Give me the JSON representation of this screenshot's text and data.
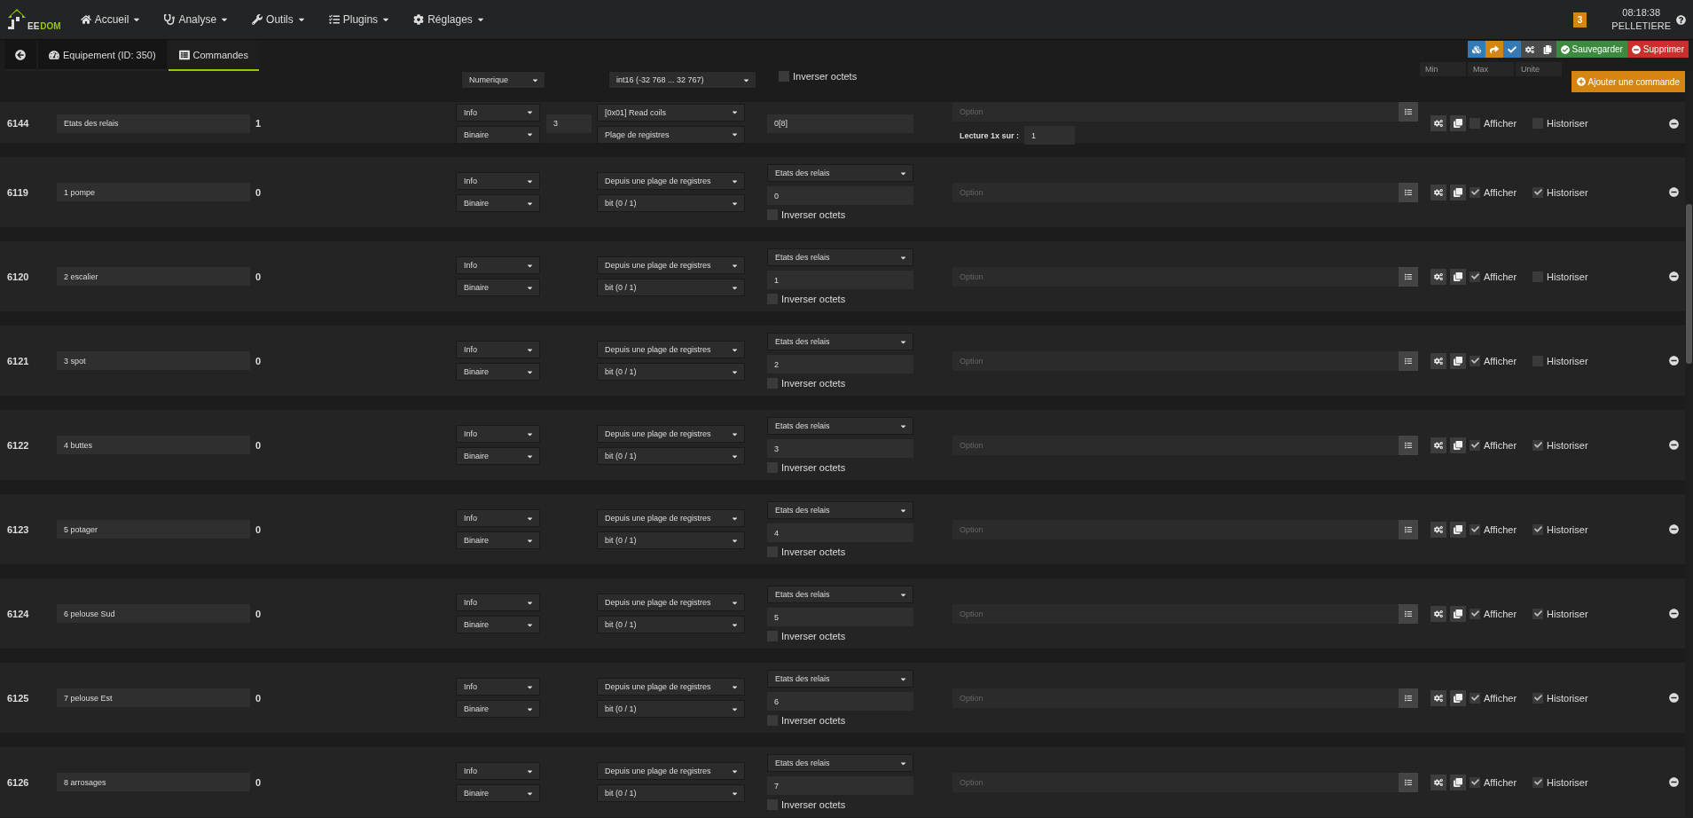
{
  "navbar": {
    "logo": {
      "light": "EE",
      "accent": "DOM"
    },
    "menu": [
      {
        "label": "Accueil",
        "kind": "home"
      },
      {
        "label": "Analyse",
        "kind": "stethoscope"
      },
      {
        "label": "Outils",
        "kind": "wrench"
      },
      {
        "label": "Plugins",
        "kind": "tasks"
      },
      {
        "label": "Réglages",
        "kind": "cog"
      }
    ],
    "badge": "3",
    "time": "08:18:38",
    "user": "PELLETIERE"
  },
  "tabs": [
    {
      "kind": "back",
      "selected": false
    },
    {
      "kind": "equipment",
      "label": "Equipement (ID: 350)",
      "selected": false
    },
    {
      "kind": "commands",
      "label": "Commandes",
      "selected": true
    }
  ],
  "toolbar": {
    "icon_buttons": [
      {
        "kind": "cubes",
        "color": "#337ab7"
      },
      {
        "kind": "share",
        "color": "#d58512"
      },
      {
        "kind": "check",
        "color": "#337ab7"
      },
      {
        "kind": "cogs",
        "color": "#4a4a4a"
      },
      {
        "kind": "copy",
        "color": "#4a4a4a"
      }
    ],
    "buttons": [
      {
        "kind": "save",
        "label": "Sauvegarder"
      },
      {
        "kind": "delete",
        "label": "Supprimer"
      }
    ]
  },
  "partial_row": {
    "subtype": "Numerique",
    "format": "int16 (-32 768 ... 32 767)",
    "invert": {
      "label": "Inverser octets",
      "checked": false
    },
    "fields": [
      {
        "placeholder": "Min"
      },
      {
        "placeholder": "Max"
      },
      {
        "placeholder": "Unite"
      }
    ]
  },
  "add_button": "Ajouter une commande",
  "rows": [
    {
      "id": "6144",
      "name": "Etats des relais",
      "value": "1",
      "type": "Info",
      "subtype": "Binaire",
      "count": "3",
      "function": "[0x01] Read coils",
      "format": "Plage de registres",
      "address": "0[8]",
      "option": "Option",
      "lecture": {
        "label": "Lecture 1x sur :",
        "value": "1"
      },
      "afficher": {
        "label": "Afficher",
        "checked": false
      },
      "historiser": {
        "label": "Historiser",
        "checked": false
      }
    },
    {
      "id": "6119",
      "name": "1 pompe",
      "value": "0",
      "type": "Info",
      "subtype": "Binaire",
      "function": "Depuis une plage de registres",
      "format": "bit (0 / 1)",
      "source": "Etats des relais",
      "address": "0",
      "invert": {
        "label": "Inverser octets",
        "checked": false
      },
      "option": "Option",
      "afficher": {
        "label": "Afficher",
        "checked": true
      },
      "historiser": {
        "label": "Historiser",
        "checked": true
      }
    },
    {
      "id": "6120",
      "name": "2 escalier",
      "value": "0",
      "type": "Info",
      "subtype": "Binaire",
      "function": "Depuis une plage de registres",
      "format": "bit (0 / 1)",
      "source": "Etats des relais",
      "address": "1",
      "invert": {
        "label": "Inverser octets",
        "checked": false
      },
      "option": "Option",
      "afficher": {
        "label": "Afficher",
        "checked": true
      },
      "historiser": {
        "label": "Historiser",
        "checked": false
      }
    },
    {
      "id": "6121",
      "name": "3 spot",
      "value": "0",
      "type": "Info",
      "subtype": "Binaire",
      "function": "Depuis une plage de registres",
      "format": "bit (0 / 1)",
      "source": "Etats des relais",
      "address": "2",
      "invert": {
        "label": "Inverser octets",
        "checked": false
      },
      "option": "Option",
      "afficher": {
        "label": "Afficher",
        "checked": true
      },
      "historiser": {
        "label": "Historiser",
        "checked": false
      }
    },
    {
      "id": "6122",
      "name": "4 buttes",
      "value": "0",
      "type": "Info",
      "subtype": "Binaire",
      "function": "Depuis une plage de registres",
      "format": "bit (0 / 1)",
      "source": "Etats des relais",
      "address": "3",
      "invert": {
        "label": "Inverser octets",
        "checked": false
      },
      "option": "Option",
      "afficher": {
        "label": "Afficher",
        "checked": true
      },
      "historiser": {
        "label": "Historiser",
        "checked": true
      }
    },
    {
      "id": "6123",
      "name": "5 potager",
      "value": "0",
      "type": "Info",
      "subtype": "Binaire",
      "function": "Depuis une plage de registres",
      "format": "bit (0 / 1)",
      "source": "Etats des relais",
      "address": "4",
      "invert": {
        "label": "Inverser octets",
        "checked": false
      },
      "option": "Option",
      "afficher": {
        "label": "Afficher",
        "checked": true
      },
      "historiser": {
        "label": "Historiser",
        "checked": true
      }
    },
    {
      "id": "6124",
      "name": "6 pelouse Sud",
      "value": "0",
      "type": "Info",
      "subtype": "Binaire",
      "function": "Depuis une plage de registres",
      "format": "bit (0 / 1)",
      "source": "Etats des relais",
      "address": "5",
      "invert": {
        "label": "Inverser octets",
        "checked": false
      },
      "option": "Option",
      "afficher": {
        "label": "Afficher",
        "checked": true
      },
      "historiser": {
        "label": "Historiser",
        "checked": true
      }
    },
    {
      "id": "6125",
      "name": "7 pelouse Est",
      "value": "0",
      "type": "Info",
      "subtype": "Binaire",
      "function": "Depuis une plage de registres",
      "format": "bit (0 / 1)",
      "source": "Etats des relais",
      "address": "6",
      "invert": {
        "label": "Inverser octets",
        "checked": false
      },
      "option": "Option",
      "afficher": {
        "label": "Afficher",
        "checked": true
      },
      "historiser": {
        "label": "Historiser",
        "checked": true
      }
    },
    {
      "id": "6126",
      "name": "8 arrosages",
      "value": "0",
      "type": "Info",
      "subtype": "Binaire",
      "function": "Depuis une plage de registres",
      "format": "bit (0 / 1)",
      "source": "Etats des relais",
      "address": "7",
      "invert": {
        "label": "Inverser octets",
        "checked": false
      },
      "option": "Option",
      "afficher": {
        "label": "Afficher",
        "checked": true
      },
      "historiser": {
        "label": "Historiser",
        "checked": true
      }
    }
  ]
}
